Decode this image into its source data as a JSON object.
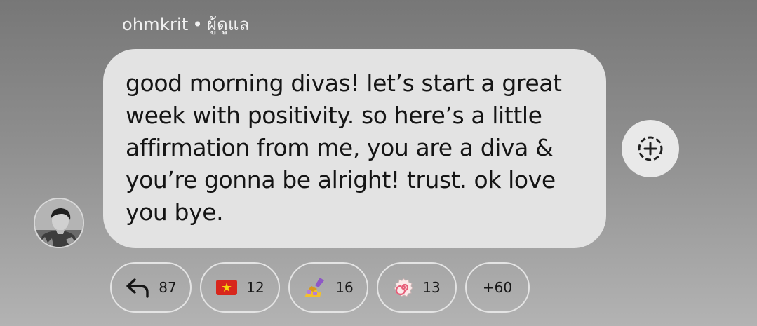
{
  "message": {
    "sender_name": "ohmkrit",
    "separator": "•",
    "sender_role": "ผู้ดูแล",
    "text": "good morning divas! let’s start a great week with positivity. so here’s a little affirmation from me, you are a diva & you’re gonna be alright! trust. ok love you bye."
  },
  "avatar": {
    "icon": "profile-photo"
  },
  "reactions": [
    {
      "icon": "reply-arrow-icon",
      "count": "87"
    },
    {
      "icon": "flag-vietnam-emoji",
      "count": "12"
    },
    {
      "icon": "nail-polish-emoji",
      "count": "16"
    },
    {
      "icon": "fish-cake-swirl-emoji",
      "count": "13"
    }
  ],
  "more_reactions": "+60",
  "add_reaction": {
    "icon": "add-reaction-icon"
  },
  "colors": {
    "bubble": "#e3e3e3",
    "text": "#151515",
    "chip_border": "#e4e4e4",
    "background_top": "#777777",
    "background_bottom": "#b3b3b3"
  }
}
